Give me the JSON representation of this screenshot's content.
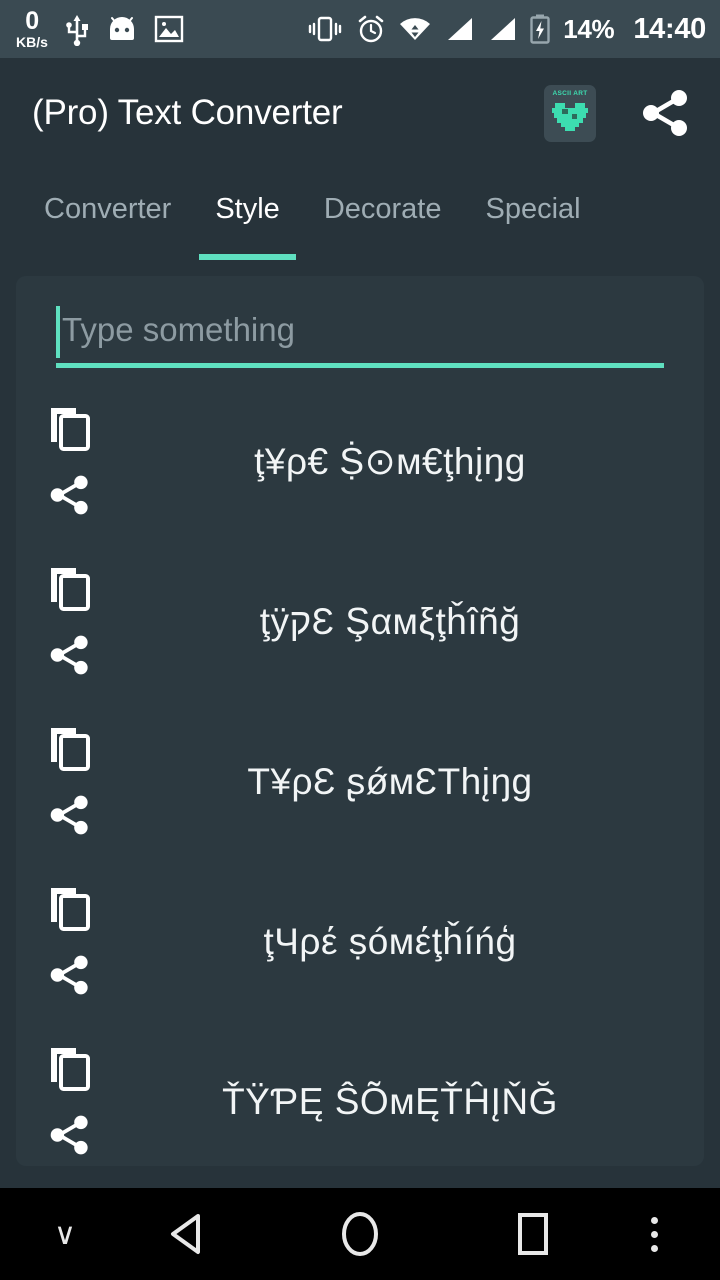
{
  "status_bar": {
    "net_speed_value": "0",
    "net_speed_unit": "KB/s",
    "icons": [
      "usb-icon",
      "android-head-icon",
      "image-icon",
      "vibrate-icon",
      "alarm-icon",
      "wifi-icon",
      "signal-sim1-icon",
      "signal-sim2-icon",
      "battery-charging-icon"
    ],
    "battery_percent": "14%",
    "clock": "14:40",
    "background_color": "#3a4a52"
  },
  "app_bar": {
    "title": "(Pro) Text Converter",
    "app_icon_label": "ASCII ART",
    "app_icon_name": "ascii-art-heart-icon",
    "share_icon_name": "share-icon",
    "accent_color": "#3ddcb0"
  },
  "tabs": {
    "active_index": 1,
    "items": [
      {
        "label": "Converter"
      },
      {
        "label": "Style"
      },
      {
        "label": "Decorate"
      },
      {
        "label": "Special"
      }
    ],
    "indicator_color": "#5fe0c0",
    "active_text_color": "#ffffff",
    "inactive_text_color": "#9fadb4"
  },
  "input": {
    "value": "",
    "placeholder": "Type something",
    "caret_color": "#5fe0c0",
    "underline_color": "#5fe0c0"
  },
  "results": {
    "copy_label": "copy-icon",
    "share_label": "share-icon",
    "rows": [
      {
        "text": "ţ¥ρ€ Ṩ⊙м€ţhįŋg"
      },
      {
        "text": "ţÿקƐ Şαмξţȟîñğ"
      },
      {
        "text": "T¥ρƐ ʂǿмƐThįŋg"
      },
      {
        "text": "ţЧρέ ṣóмέţȟíńģ"
      },
      {
        "text": "ŤŸƤĘ ŜÕмĘŤĤĮŇĞ"
      }
    ]
  },
  "nav_bar": {
    "collapse_label": "∨",
    "back_icon": "back-triangle-icon",
    "home_icon": "home-circle-icon",
    "recents_icon": "recents-square-icon",
    "menu_icon": "overflow-menu-icon",
    "background_color": "#000000"
  }
}
